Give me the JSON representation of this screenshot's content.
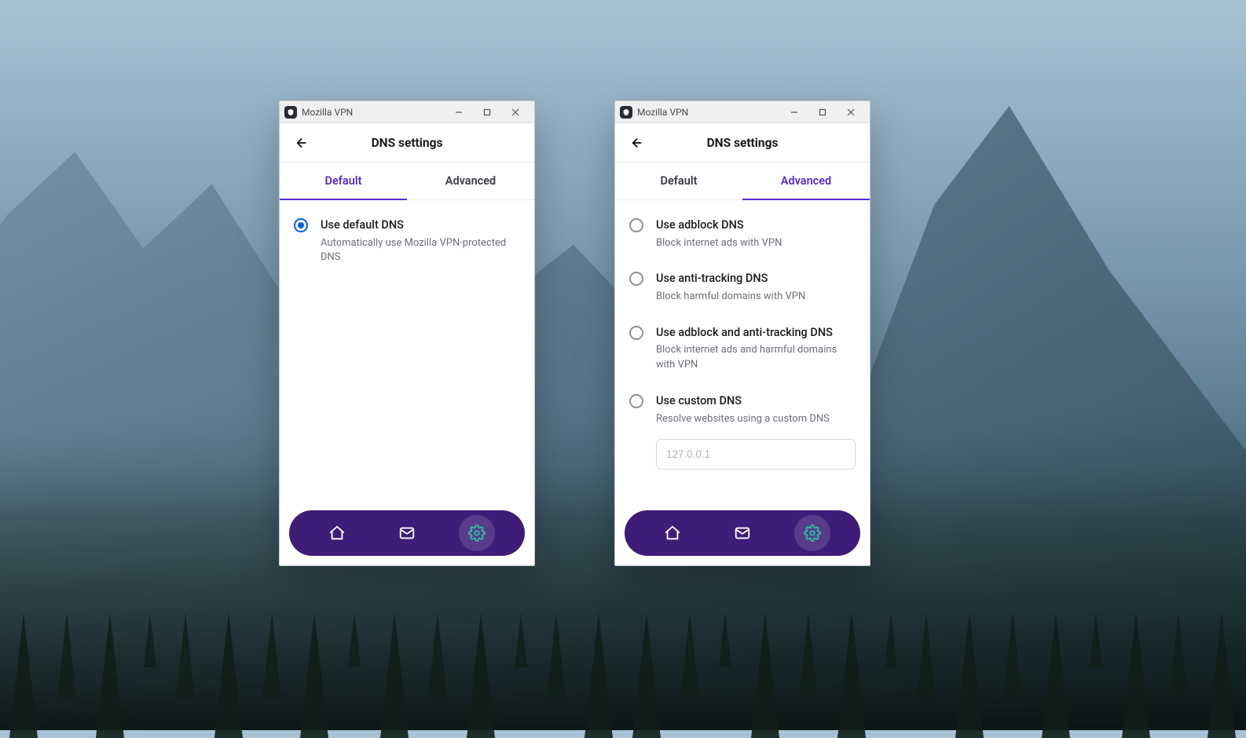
{
  "app_title": "Mozilla VPN",
  "header_title": "DNS settings",
  "tabs": {
    "default": "Default",
    "advanced": "Advanced"
  },
  "left": {
    "active_tab": "default",
    "options": {
      "default_dns": {
        "title": "Use default DNS",
        "desc": "Automatically use Mozilla VPN-protected DNS",
        "selected": true
      }
    }
  },
  "right": {
    "active_tab": "advanced",
    "options": {
      "adblock": {
        "title": "Use adblock DNS",
        "desc": "Block internet ads with VPN"
      },
      "antitracking": {
        "title": "Use anti-tracking DNS",
        "desc": "Block harmful domains with VPN"
      },
      "both": {
        "title": "Use adblock and anti-tracking DNS",
        "desc": "Block internet ads and harmful domains with VPN"
      },
      "custom": {
        "title": "Use custom DNS",
        "desc": "Resolve websites using a custom DNS",
        "placeholder": "127.0.0.1"
      }
    }
  },
  "nav": {
    "home": "home",
    "messages": "messages",
    "settings": "settings"
  }
}
